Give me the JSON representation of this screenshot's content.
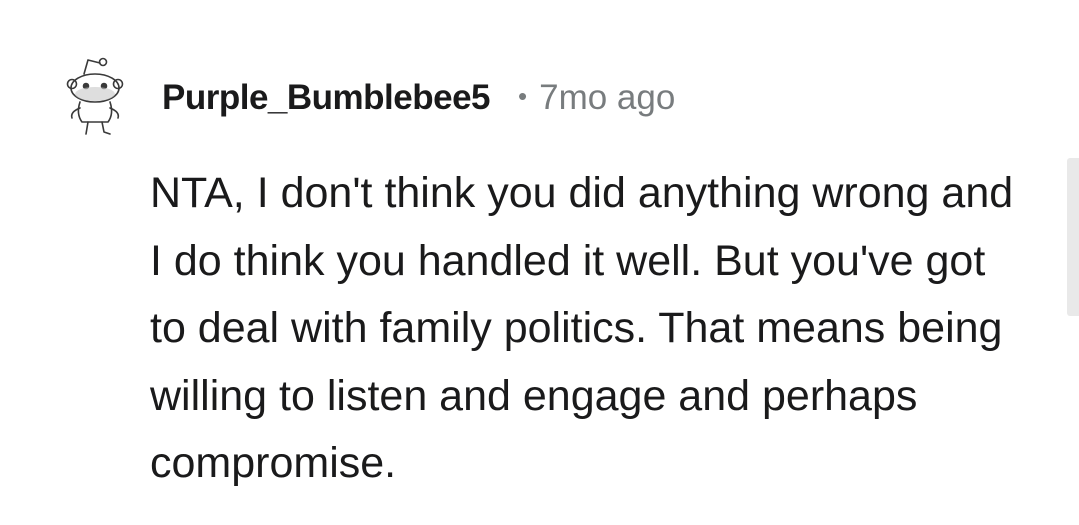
{
  "comment": {
    "author": "Purple_Bumblebee5",
    "separator": "•",
    "timestamp": "7mo ago",
    "body": "NTA, I don't think you did anything wrong and I do think you handled it well. But you've got to deal with family politics. That means being willing to listen and engage and perhaps compromise.",
    "avatar_icon": "snoo-avatar-icon"
  },
  "colors": {
    "text": "#1a1a1b",
    "meta": "#787c7e",
    "background": "#ffffff",
    "scrollbar": "#e9e9e9"
  }
}
